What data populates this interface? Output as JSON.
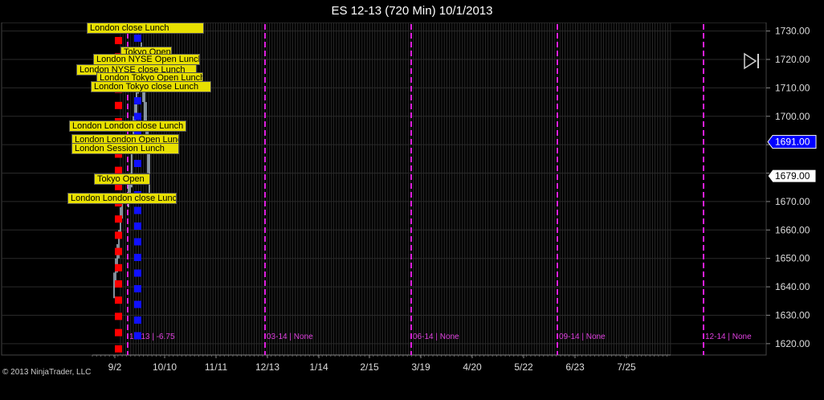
{
  "title": "ES 12-13 (720 Min)  10/1/2013",
  "copyright": "© 2013 NinjaTrader, LLC",
  "colors": {
    "background": "#000000",
    "grid": "#2a2a2a",
    "axis_text": "#dddddd",
    "contract_line": "#e020e0",
    "contract_label": "#e040e0",
    "red_marker": "#ff0000",
    "blue_marker": "#1010ff",
    "session_label_bg": "#e8e000",
    "last_price_bg": "#0000ff"
  },
  "price_axis": {
    "ticks": [
      "1730.00",
      "1720.00",
      "1710.00",
      "1700.00",
      "1690.00",
      "1680.00",
      "1670.00",
      "1660.00",
      "1650.00",
      "1640.00",
      "1630.00",
      "1620.00"
    ],
    "tick_values": [
      1730,
      1720,
      1710,
      1700,
      1690,
      1680,
      1670,
      1660,
      1650,
      1640,
      1630,
      1620
    ],
    "range": [
      1616,
      1733
    ],
    "last_price": {
      "label": "1691.00",
      "value": 1691
    },
    "marker_price": {
      "label": "1679.00",
      "value": 1679
    }
  },
  "time_axis": {
    "ticks": [
      "9/2",
      "10/10",
      "11/11",
      "12/13",
      "1/14",
      "2/15",
      "3/19",
      "4/20",
      "5/22",
      "6/23",
      "7/25"
    ]
  },
  "contract_rollovers": [
    {
      "label": "12-13 | -6.75"
    },
    {
      "label": "03-14 | None"
    },
    {
      "label": "06-14 | None"
    },
    {
      "label": "09-14 | None"
    },
    {
      "label": "12-14 | None"
    }
  ],
  "session_labels": [
    "London close Lunch",
    "Tokyo Open",
    "London NYSE Open Lunch",
    "London NYSE close Lunch",
    "London Tokyo Open Lunch",
    "London Tokyo close Lunch",
    "London London close Lunch",
    "London London Open Lunch",
    "London Session Lunch",
    "Tokyo Open",
    "London London close Lunch"
  ],
  "toolbar": {
    "icon": "skip-to-end-icon"
  }
}
